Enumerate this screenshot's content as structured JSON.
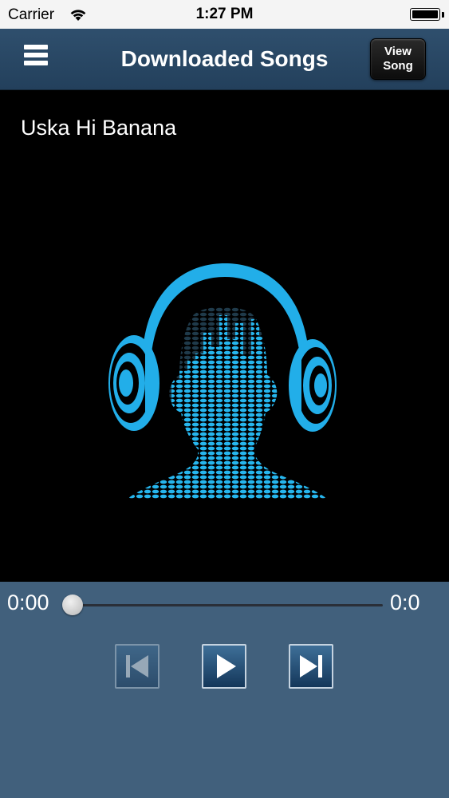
{
  "status_bar": {
    "carrier": "Carrier",
    "time": "1:27 PM",
    "battery_level": 1.0
  },
  "nav_bar": {
    "title": "Downloaded Songs",
    "view_song_line1": "View",
    "view_song_line2": "Song"
  },
  "now_playing": {
    "song_title": "Uska Hi Banana",
    "elapsed": "0:00",
    "duration": "0:0",
    "progress": 0.0
  },
  "controls": {
    "previous_enabled": false,
    "play_enabled": true,
    "next_enabled": true
  },
  "colors": {
    "nav_bar": "#2a4866",
    "artwork_bg": "#000000",
    "accent_cyan": "#22aee9",
    "controls_bg": "#41607c"
  }
}
